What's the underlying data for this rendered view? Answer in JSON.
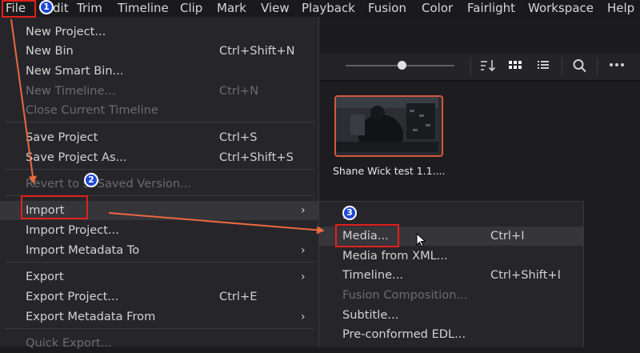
{
  "menubar": {
    "items": [
      "File",
      "dit",
      "Trim",
      "Timeline",
      "Clip",
      "Mark",
      "View",
      "Playback",
      "Fusion",
      "Color",
      "Fairlight",
      "Workspace",
      "Help"
    ]
  },
  "file_menu": {
    "items": [
      {
        "label": "New Project...",
        "shortcut": ""
      },
      {
        "label": "New Bin",
        "shortcut": "Ctrl+Shift+N"
      },
      {
        "label": "New Smart Bin...",
        "shortcut": ""
      },
      {
        "label": "New Timeline...",
        "shortcut": "Ctrl+N"
      },
      {
        "label": "Close Current Timeline",
        "shortcut": ""
      },
      {
        "label": "Save Project",
        "shortcut": "Ctrl+S"
      },
      {
        "label": "Save Project As...",
        "shortcut": "Ctrl+Shift+S"
      },
      {
        "label": "Revert to   st Saved Version...",
        "shortcut": ""
      },
      {
        "label": "Import",
        "shortcut": ""
      },
      {
        "label": "Import Project...",
        "shortcut": ""
      },
      {
        "label": "Import Metadata To",
        "shortcut": ""
      },
      {
        "label": "Export",
        "shortcut": ""
      },
      {
        "label": "Export Project...",
        "shortcut": "Ctrl+E"
      },
      {
        "label": "Export Metadata From",
        "shortcut": ""
      },
      {
        "label": "Quick Export...",
        "shortcut": ""
      }
    ],
    "submenu_arrow": "›"
  },
  "import_submenu": {
    "items": [
      {
        "label": "...",
        "shortcut": ""
      },
      {
        "label": "Media...",
        "shortcut": "Ctrl+I"
      },
      {
        "label": "Media from XML...",
        "shortcut": ""
      },
      {
        "label": "Timeline...",
        "shortcut": "Ctrl+Shift+I"
      },
      {
        "label": "Fusion Composition...",
        "shortcut": ""
      },
      {
        "label": "Subtitle...",
        "shortcut": ""
      },
      {
        "label": "Pre-conformed EDL...",
        "shortcut": ""
      }
    ]
  },
  "media_pool": {
    "clip_name": "Shane Wick test 1.1....",
    "toolbar_icons": [
      "sort-icon",
      "grid-view-icon",
      "list-view-icon",
      "search-icon",
      "more-options-icon"
    ]
  },
  "annotations": {
    "badges": [
      "1",
      "2",
      "3"
    ],
    "callout_color": "#e2211c",
    "arrow_color": "#e8693f",
    "badge_color": "#1d47d8"
  },
  "colors": {
    "clip_border": "#d4583c",
    "menu_bg": "#26262a",
    "highlight_bg": "#35353a"
  }
}
